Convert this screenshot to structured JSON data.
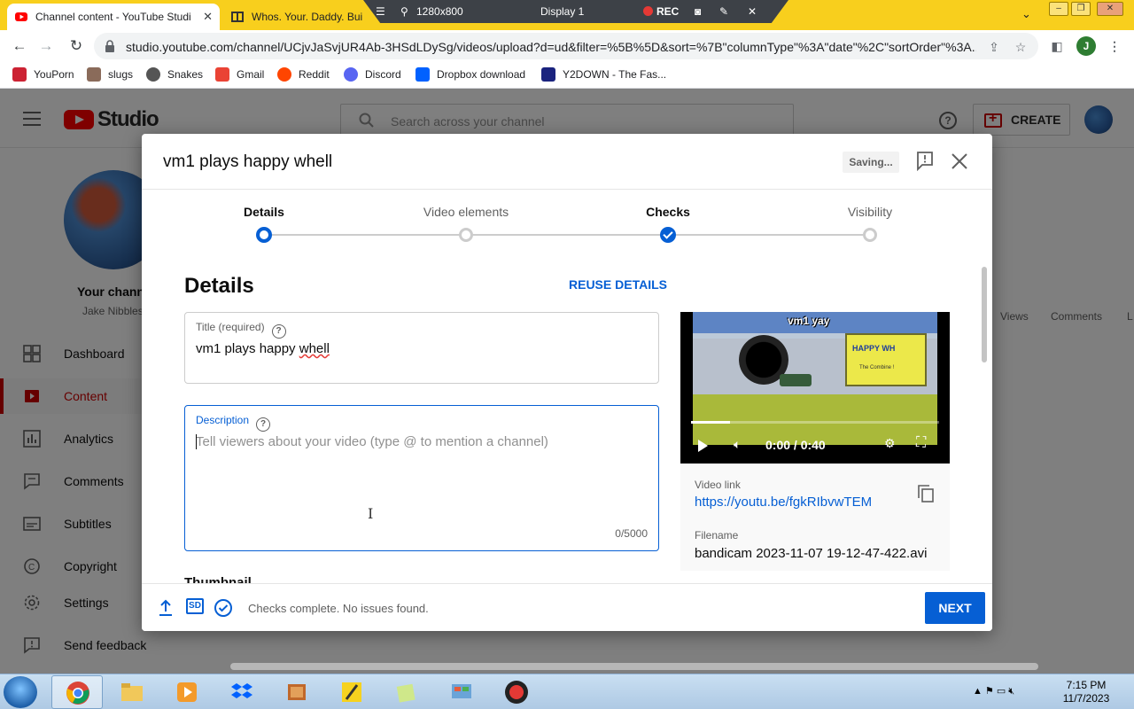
{
  "browser": {
    "active_tab_title": "Channel content - YouTube Studi",
    "inactive_tab_title": "Whos. Your. Daddy. Bui",
    "url": "studio.youtube.com/channel/UCjvJaSvjUR4Ab-3HSdLDySg/videos/upload?d=ud&filter=%5B%5D&sort=%7B\"columnType\"%3A\"date\"%2C\"sortOrder\"%3A...",
    "profile_initial": "J"
  },
  "recorder": {
    "resolution": "1280x800",
    "display": "Display 1",
    "rec_label": "REC"
  },
  "bookmarks": [
    {
      "label": "YouPorn",
      "color": "#cc2233"
    },
    {
      "label": "slugs",
      "color": "#8a6b5a"
    },
    {
      "label": "Snakes",
      "color": "#555555"
    },
    {
      "label": "Gmail",
      "color": "#ea4335"
    },
    {
      "label": "Reddit",
      "color": "#ff4500"
    },
    {
      "label": "Discord",
      "color": "#5865f2"
    },
    {
      "label": "Dropbox download",
      "color": "#0061ff"
    },
    {
      "label": "Y2DOWN - The Fas...",
      "color": "#1a237e"
    }
  ],
  "studio": {
    "logo_text": "Studio",
    "search_placeholder": "Search across your channel",
    "create_label": "CREATE",
    "channel_name": "Your channel",
    "channel_handle": "Jake Nibbles",
    "sidebar": [
      {
        "label": "Dashboard",
        "icon": "dashboard-icon"
      },
      {
        "label": "Content",
        "icon": "content-icon"
      },
      {
        "label": "Analytics",
        "icon": "analytics-icon"
      },
      {
        "label": "Comments",
        "icon": "comments-icon"
      },
      {
        "label": "Subtitles",
        "icon": "subtitles-icon"
      },
      {
        "label": "Copyright",
        "icon": "copyright-icon"
      },
      {
        "label": "Settings",
        "icon": "gear-icon"
      },
      {
        "label": "Send feedback",
        "icon": "feedback-icon"
      }
    ],
    "columns": [
      "Views",
      "Comments",
      "L"
    ]
  },
  "dialog": {
    "title": "vm1 plays happy whell",
    "saving_status": "Saving...",
    "steps": [
      {
        "label": "Details",
        "state": "current"
      },
      {
        "label": "Video elements",
        "state": "todo"
      },
      {
        "label": "Checks",
        "state": "done"
      },
      {
        "label": "Visibility",
        "state": "todo"
      }
    ],
    "section_title": "Details",
    "reuse_label": "REUSE DETAILS",
    "title_field": {
      "label": "Title (required)",
      "value_prefix": "vm1 plays happy ",
      "value_misspelled": "whell"
    },
    "description_field": {
      "label": "Description",
      "placeholder": "Tell viewers about your video (type @ to mention a channel)",
      "counter": "0/5000"
    },
    "thumbnail_heading": "Thumbnail",
    "preview": {
      "overlay_text": "vm1 yay",
      "sign_text": "HAPPY WH",
      "sign_subtext": "The Combine !",
      "time": "0:00 / 0:40",
      "progress": 0.0,
      "video_link_label": "Video link",
      "video_link": "https://youtu.be/fgkRIbvwTEM",
      "filename_label": "Filename",
      "filename": "bandicam 2023-11-07 19-12-47-422.avi"
    },
    "footer": {
      "quality_badge": "SD",
      "status": "Checks complete. No issues found.",
      "next_label": "NEXT"
    }
  },
  "taskbar": {
    "time": "7:15 PM",
    "date": "11/7/2023"
  },
  "colors": {
    "accent": "#065fd4",
    "brand_red": "#ff0000",
    "tab_strip": "#f8cf1d"
  }
}
